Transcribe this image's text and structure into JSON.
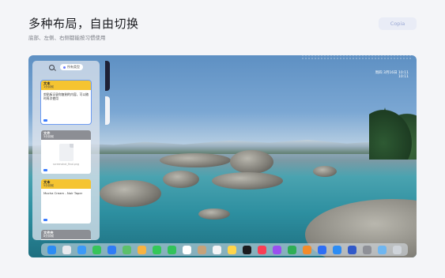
{
  "header": {
    "title": "多种布局，自由切换",
    "subtitle": "底部、左侧、右侧都能按习惯使用",
    "copy_button": "Copia"
  },
  "desktop": {
    "menubar_right": "",
    "clock_date": "周四 3月16日 10:11",
    "clock_time": "10:11"
  },
  "panel": {
    "filter_label": "所有类型",
    "cards": [
      {
        "type": "文本",
        "time": "1分钟前",
        "body": "剪贴板记录你复制的内容，可以随时再次使用",
        "style": "yellow"
      },
      {
        "type": "文件",
        "time": "3分钟前",
        "file_name": "screenshot_final.png",
        "style": "gray"
      },
      {
        "type": "文本",
        "time": "5分钟前",
        "body": "Mocha Cream - Noir Taper",
        "style": "yellow"
      },
      {
        "type": "文件夹",
        "time": "8分钟前",
        "style": "gray"
      }
    ]
  },
  "dock": {
    "apps": [
      {
        "name": "finder-icon",
        "color": "#2c8cf4"
      },
      {
        "name": "launchpad-icon",
        "color": "#e8e9ee"
      },
      {
        "name": "safari-icon",
        "color": "#3c9af8"
      },
      {
        "name": "messages-icon",
        "color": "#37c45a"
      },
      {
        "name": "mail-icon",
        "color": "#2f7cf6"
      },
      {
        "name": "maps-icon",
        "color": "#5cc06a"
      },
      {
        "name": "photos-icon",
        "color": "#f7b341"
      },
      {
        "name": "facetime-icon",
        "color": "#34c759"
      },
      {
        "name": "phone-icon",
        "color": "#32c25a"
      },
      {
        "name": "calendar-icon",
        "color": "#ffffff"
      },
      {
        "name": "contacts-icon",
        "color": "#c6a27a"
      },
      {
        "name": "reminders-icon",
        "color": "#f4f4f6"
      },
      {
        "name": "notes-icon",
        "color": "#ffd54a"
      },
      {
        "name": "tv-icon",
        "color": "#1b1b1e"
      },
      {
        "name": "music-icon",
        "color": "#fa3e55"
      },
      {
        "name": "podcasts-icon",
        "color": "#9b4ff0"
      },
      {
        "name": "numbers-icon",
        "color": "#2fae55"
      },
      {
        "name": "pages-icon",
        "color": "#f38b2a"
      },
      {
        "name": "keynote-icon",
        "color": "#2e6ef5"
      },
      {
        "name": "app-store-icon",
        "color": "#2c8cf4"
      },
      {
        "name": "pasty-icon",
        "color": "#3159c9"
      },
      {
        "name": "settings-icon",
        "color": "#8e9097"
      },
      {
        "name": "folder-icon",
        "color": "#6fb6f0"
      },
      {
        "name": "trash-icon",
        "color": "#cfd4da"
      }
    ]
  }
}
